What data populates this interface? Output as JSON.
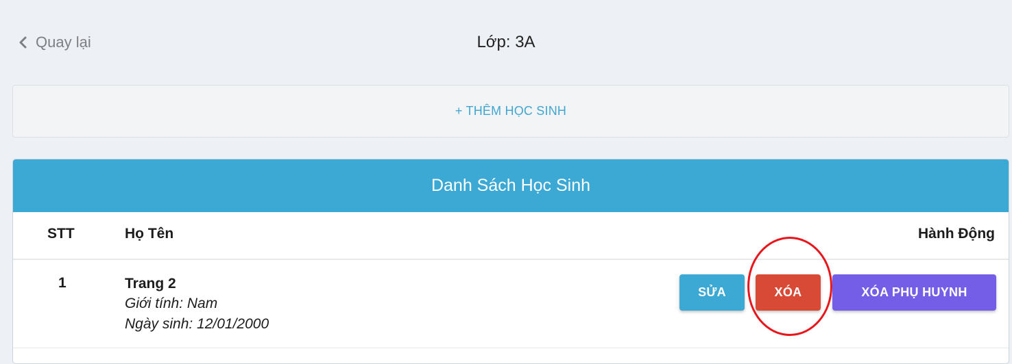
{
  "header": {
    "back_label": "Quay lại",
    "back_icon": "chevron-left-icon",
    "class_title": "Lớp: 3A"
  },
  "add_student": {
    "label": "+ THÊM HỌC SINH"
  },
  "student_list": {
    "title": "Danh Sách Học Sinh",
    "columns": {
      "index": "STT",
      "name": "Họ Tên",
      "actions": "Hành Động"
    },
    "rows": [
      {
        "index": "1",
        "name": "Trang 2",
        "gender": "Giới tính: Nam",
        "birthdate": "Ngày sinh: 12/01/2000",
        "actions": {
          "edit": "SỬA",
          "delete": "XÓA",
          "delete_parent": "XÓA PHỤ HUYNH"
        }
      }
    ]
  },
  "colors": {
    "background": "#edf0f4",
    "header_blue": "#3ca8d4",
    "edit_button": "#3ca8d4",
    "delete_button": "#d84a35",
    "delete_parent_button": "#745ee8",
    "add_link": "#3fa6d2",
    "highlight": "#e8161b"
  }
}
